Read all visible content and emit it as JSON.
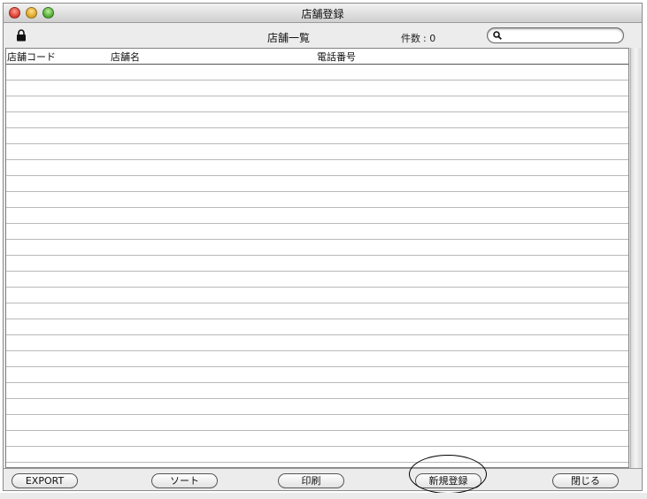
{
  "window": {
    "title": "店舗登録"
  },
  "toolbar": {
    "list_title": "店舗一覧",
    "count_label": "件数",
    "count_separator": ":",
    "count_value": "0",
    "search": {
      "value": "",
      "placeholder": ""
    }
  },
  "table": {
    "columns": [
      "店舗コード",
      "店舗名",
      "電話番号"
    ],
    "rows": []
  },
  "footer": {
    "buttons": {
      "export": "EXPORT",
      "sort": "ソート",
      "print": "印刷",
      "new": "新規登録",
      "close": "閉じる"
    }
  },
  "icons": {
    "lock": "lock-icon",
    "search": "search-icon"
  },
  "colors": {
    "close_button": "#d9382a",
    "minimize_button": "#d9a21f",
    "zoom_button": "#4ea62f"
  }
}
